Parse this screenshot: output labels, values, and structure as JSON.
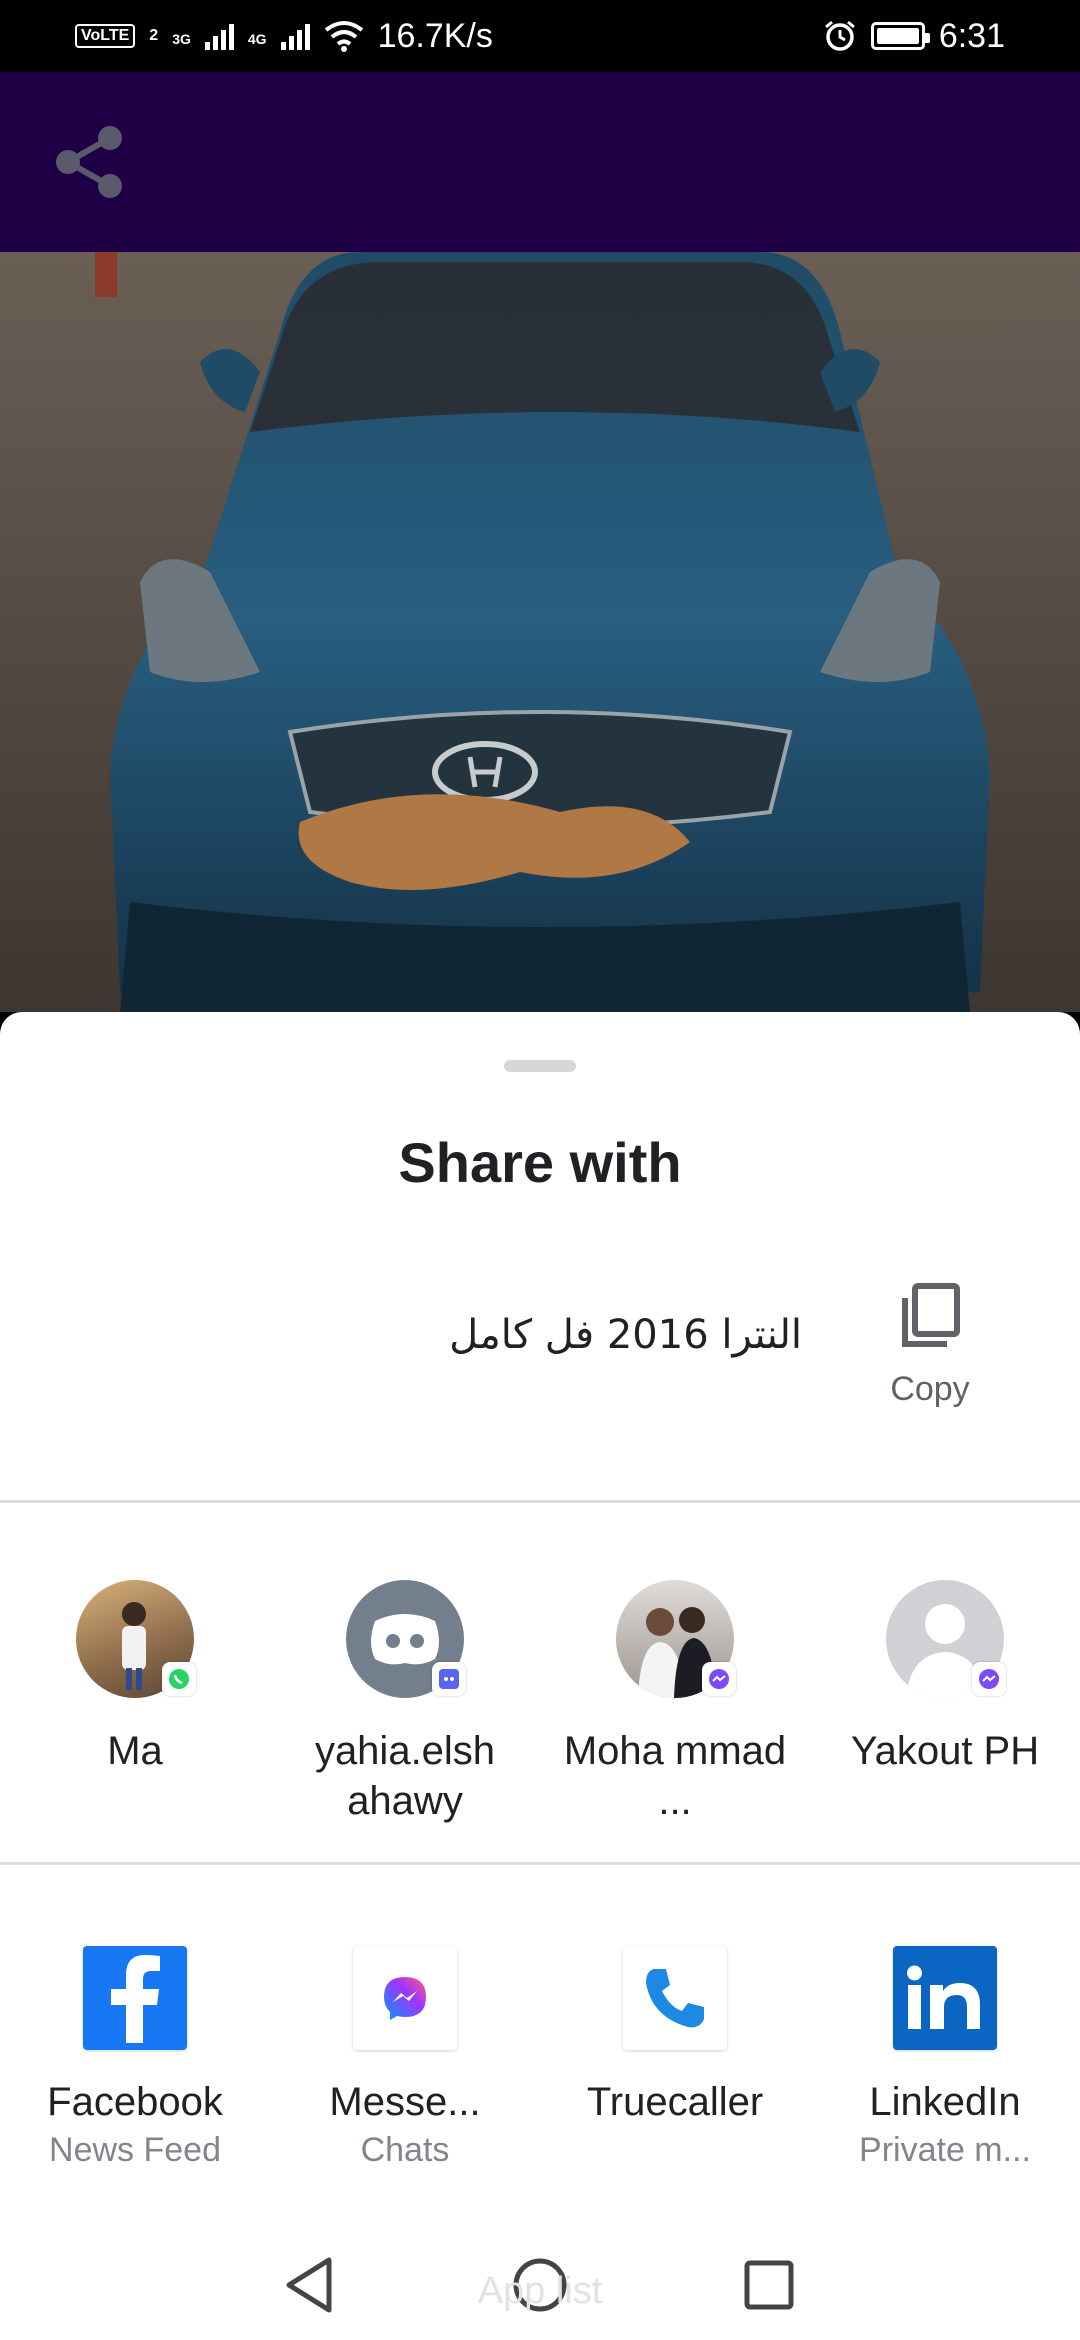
{
  "status_bar": {
    "volte": "VoLTE",
    "sim_slot": "2",
    "net1": "3G",
    "net2": "4G",
    "speed": "16.7K/s",
    "time": "6:31"
  },
  "sheet": {
    "title": "Share with",
    "preview_text": "النترا 2016 فل كامل",
    "copy_label": "Copy"
  },
  "direct_targets": [
    {
      "name": "Ma",
      "badge": "whatsapp-icon"
    },
    {
      "name": "yahia.elsh ahawy",
      "badge": "discord-icon"
    },
    {
      "name": "Moha mmad ...",
      "badge": "messenger-icon"
    },
    {
      "name": "Yakout PH",
      "badge": "messenger-icon"
    }
  ],
  "apps": [
    {
      "name": "Facebook",
      "sub": "News Feed",
      "icon": "facebook-icon",
      "color": "#1877f2"
    },
    {
      "name": "Messe...",
      "sub": "Chats",
      "icon": "messenger-icon",
      "color": "#a334fa"
    },
    {
      "name": "Truecaller",
      "sub": "",
      "icon": "phone-icon",
      "color": "#1e88e5"
    },
    {
      "name": "LinkedIn",
      "sub": "Private m...",
      "icon": "linkedin-icon",
      "color": "#0a66c2"
    }
  ],
  "nav": {
    "ghost_label": "App list"
  },
  "colors": {
    "app_bar": "#1f0047",
    "whatsapp": "#25d366",
    "discord": "#5865f2"
  }
}
